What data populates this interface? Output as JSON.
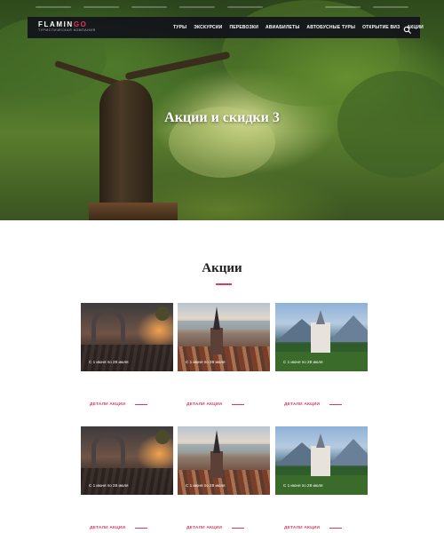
{
  "nav": {
    "logo_main_a": "FLAMIN",
    "logo_main_b": "GO",
    "logo_sub": "ТУРИСТИЧЕСКАЯ КОМПАНИЯ",
    "items": [
      "ТУРЫ",
      "ЭКСКУРСИИ",
      "ПЕРЕВОЗКИ",
      "АВИАБИЛЕТЫ",
      "АВТОБУСНЫЕ ТУРЫ",
      "ОТКРЫТИЕ ВИЗ",
      "АКЦИИ"
    ],
    "search_icon": "search-icon"
  },
  "hero": {
    "title": "Акции и скидки 3"
  },
  "section": {
    "title": "Акции",
    "accent_color": "#e1365e"
  },
  "cards": [
    {
      "date": "С 1 июня по 28 июля",
      "link": "ДЕТАЛИ АКЦИИ",
      "image": "street-sunset"
    },
    {
      "date": "С 1 июня по 28 июля",
      "link": "ДЕТАЛИ АКЦИИ",
      "image": "riga-city"
    },
    {
      "date": "С 1 июня по 28 июля",
      "link": "ДЕТАЛИ АКЦИИ",
      "image": "castle"
    },
    {
      "date": "С 1 июня по 28 июля",
      "link": "ДЕТАЛИ АКЦИИ",
      "image": "street-sunset"
    },
    {
      "date": "С 1 июня по 28 июля",
      "link": "ДЕТАЛИ АКЦИИ",
      "image": "riga-city"
    },
    {
      "date": "С 1 июня по 28 июля",
      "link": "ДЕТАЛИ АКЦИИ",
      "image": "castle"
    }
  ]
}
